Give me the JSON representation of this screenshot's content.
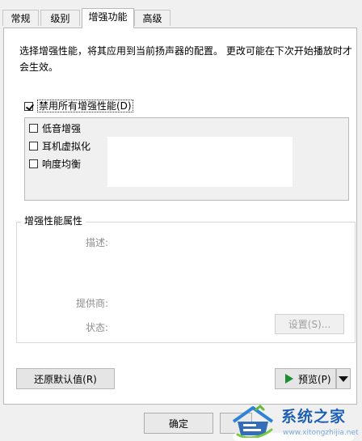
{
  "tabs": [
    {
      "label": "常规"
    },
    {
      "label": "级别"
    },
    {
      "label": "增强功能",
      "active": true
    },
    {
      "label": "高级"
    }
  ],
  "description": "选择增强性能，将其应用到当前扬声器的配置。 更改可能在下次开始播放时才会生效。",
  "disable_all": {
    "label": "禁用所有增强性能(D)",
    "checked": true
  },
  "enhancements": [
    {
      "label": "低音增强",
      "checked": false
    },
    {
      "label": "耳机虚拟化",
      "checked": false
    },
    {
      "label": "响度均衡",
      "checked": false
    }
  ],
  "properties": {
    "group_title": "增强性能属性",
    "description_label": "描述:",
    "provider_label": "提供商:",
    "status_label": "状态:",
    "settings_button": "设置(S)..."
  },
  "buttons": {
    "restore_defaults": "还原默认值(R)",
    "preview": "预览(P)",
    "ok": "确定"
  },
  "watermark": {
    "title": "系统之家",
    "url": "www.xitongzhijia.net"
  },
  "colors": {
    "window_bg": "#f0f0f0",
    "panel_bg": "#ffffff",
    "border": "#b9b9b9",
    "play_green": "#1b8f2f",
    "watermark_blue": "#1f5fb3"
  }
}
